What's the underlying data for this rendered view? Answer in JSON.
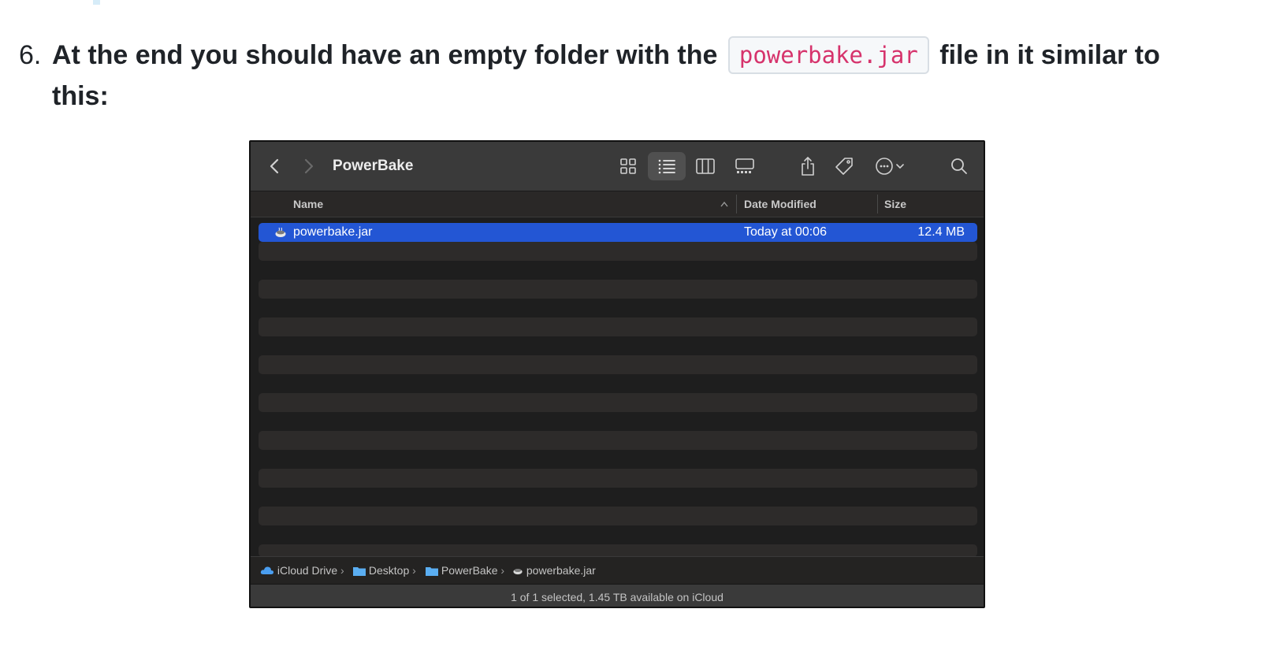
{
  "step": {
    "number": "6.",
    "text_before": "At the end you should have an empty folder with the ",
    "code": "powerbake.jar",
    "text_after": " file in it similar to this:"
  },
  "finder": {
    "title": "PowerBake",
    "columns": {
      "name": "Name",
      "date": "Date Modified",
      "size": "Size"
    },
    "file": {
      "name": "powerbake.jar",
      "date": "Today at 00:06",
      "size": "12.4 MB"
    },
    "path": [
      "iCloud Drive",
      "Desktop",
      "PowerBake",
      "powerbake.jar"
    ],
    "status": "1 of 1 selected, 1.45 TB available on iCloud",
    "colors": {
      "selection": "#2356d4",
      "toolbar": "#3a3a3a",
      "background": "#1e1e1e",
      "code_text": "#d6336c"
    },
    "icons": [
      "back-icon",
      "forward-icon",
      "icon-view-icon",
      "list-view-icon",
      "column-view-icon",
      "gallery-view-icon",
      "share-icon",
      "tag-icon",
      "more-icon",
      "search-icon"
    ]
  }
}
